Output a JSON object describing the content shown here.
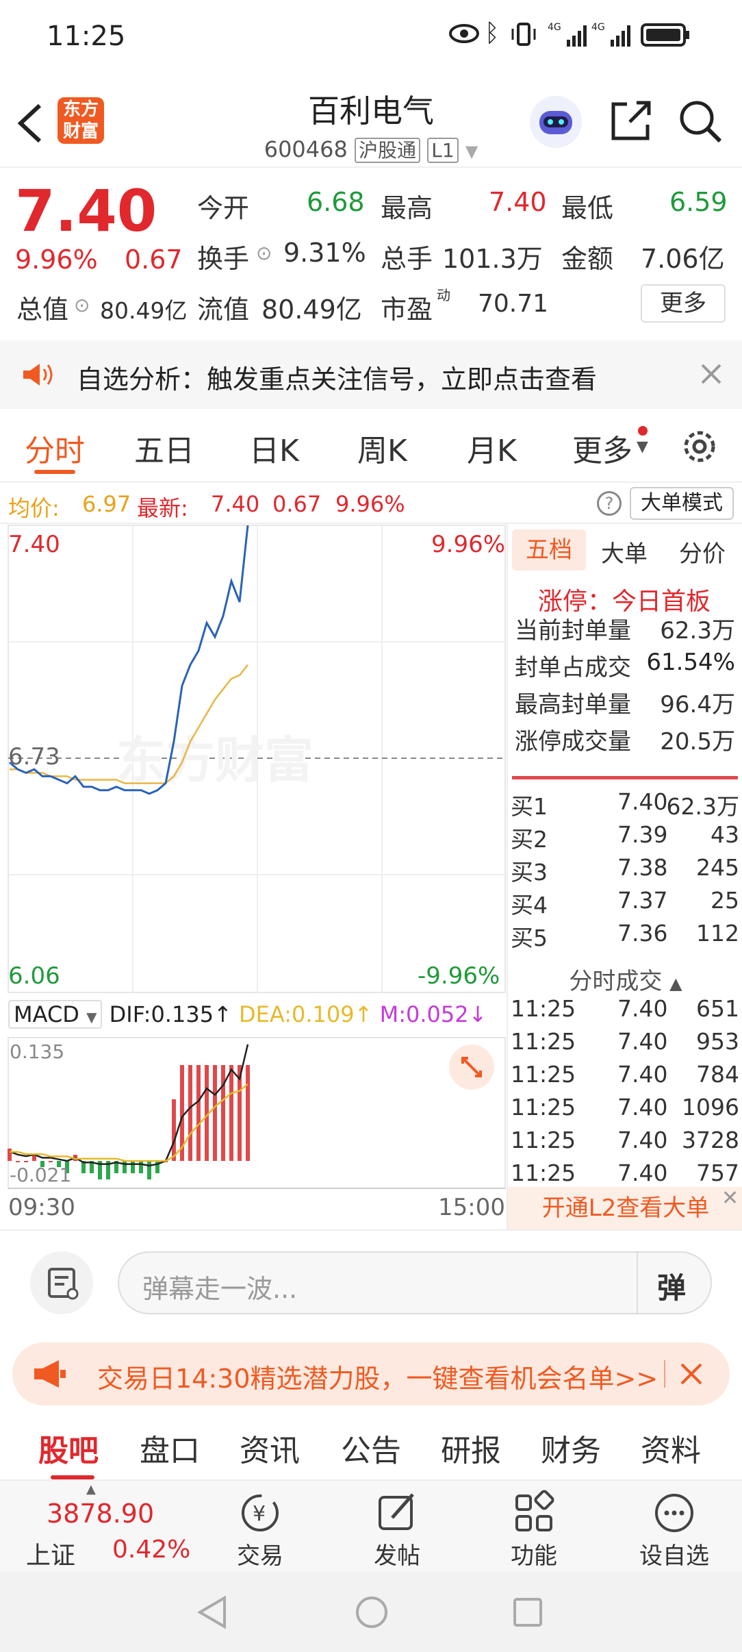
{
  "status": {
    "time": "11:25",
    "net1": "4G",
    "net2": "4G"
  },
  "header": {
    "logo": "东方财富",
    "title": "百利电气",
    "code": "600468",
    "exchange": "沪股通",
    "level": "L1"
  },
  "quote": {
    "price": "7.40",
    "change_pct": "9.96%",
    "change": "0.67",
    "open_label": "今开",
    "open": "6.68",
    "high_label": "最高",
    "high": "7.40",
    "low_label": "最低",
    "low": "6.59",
    "turnover_label": "换手",
    "turnover": "9.31%",
    "volume_label": "总手",
    "volume": "101.3万",
    "amount_label": "金额",
    "amount": "7.06亿",
    "mcap_label": "总值",
    "mcap": "80.49亿",
    "float_label": "流值",
    "float": "80.49亿",
    "pe_label": "市盈",
    "pe_sup": "动",
    "pe": "70.71",
    "more": "更多"
  },
  "notice": {
    "text": "自选分析：触发重点关注信号，立即点击查看"
  },
  "tabs": [
    "分时",
    "五日",
    "日K",
    "周K",
    "月K",
    "更多"
  ],
  "avgbar": {
    "avg_label": "均价:",
    "avg": "6.97",
    "last_label": "最新:",
    "last": "7.40",
    "chg": "0.67",
    "pct": "9.96%",
    "mode": "大单模式"
  },
  "chart": {
    "top_price": "7.40",
    "top_pct": "9.96%",
    "mid_price": "6.73",
    "bottom_price": "6.06",
    "bottom_pct": "-9.96%",
    "start_time": "09:30",
    "end_time": "15:00"
  },
  "chart_data": {
    "type": "line",
    "title": "",
    "xlabel": "",
    "ylabel": "",
    "ylim": [
      6.06,
      7.4
    ],
    "reference": 6.73,
    "series": [
      {
        "name": "最新",
        "values": [
          6.72,
          6.7,
          6.69,
          6.7,
          6.68,
          6.68,
          6.67,
          6.66,
          6.68,
          6.65,
          6.65,
          6.64,
          6.64,
          6.65,
          6.64,
          6.64,
          6.64,
          6.63,
          6.64,
          6.66,
          6.78,
          6.94,
          7.0,
          7.04,
          7.12,
          7.08,
          7.14,
          7.24,
          7.18,
          7.4
        ]
      },
      {
        "name": "均价",
        "values": [
          6.7,
          6.7,
          6.69,
          6.69,
          6.69,
          6.68,
          6.68,
          6.68,
          6.67,
          6.67,
          6.67,
          6.67,
          6.67,
          6.67,
          6.66,
          6.66,
          6.66,
          6.66,
          6.66,
          6.66,
          6.68,
          6.72,
          6.78,
          6.82,
          6.86,
          6.9,
          6.93,
          6.96,
          6.97,
          7.0
        ]
      }
    ]
  },
  "macd": {
    "label": "MACD",
    "dif": "DIF:0.135",
    "dea": "DEA:0.109",
    "m": "M:0.052",
    "top": "0.135",
    "bottom": "-0.021"
  },
  "side": {
    "tabs": [
      "五档",
      "大单",
      "分价"
    ],
    "limit": "涨停：今日首板",
    "stats": [
      [
        "当前封单量",
        "62.3万"
      ],
      [
        "封单占成交",
        "61.54%"
      ],
      [
        "最高封单量",
        "96.4万"
      ],
      [
        "涨停成交量",
        "20.5万"
      ]
    ],
    "book": [
      [
        "买1",
        "7.40",
        "62.3万"
      ],
      [
        "买2",
        "7.39",
        "43"
      ],
      [
        "买3",
        "7.38",
        "245"
      ],
      [
        "买4",
        "7.37",
        "25"
      ],
      [
        "买5",
        "7.36",
        "112"
      ]
    ],
    "trades_title": "分时成交",
    "trades": [
      [
        "11:25",
        "7.40",
        "651"
      ],
      [
        "11:25",
        "7.40",
        "953"
      ],
      [
        "11:25",
        "7.40",
        "784"
      ],
      [
        "11:25",
        "7.40",
        "1096"
      ],
      [
        "11:25",
        "7.40",
        "3728"
      ],
      [
        "11:25",
        "7.40",
        "757"
      ]
    ],
    "l2": "开通L2查看大单"
  },
  "danmu": {
    "placeholder": "弹幕走一波...",
    "btn": "弹"
  },
  "promo": {
    "text": "交易日14:30精选潜力股，一键查看机会名单>>"
  },
  "subtabs": [
    "股吧",
    "盘口",
    "资讯",
    "公告",
    "研报",
    "财务",
    "资料"
  ],
  "bottom": {
    "index_value": "3878.90",
    "index_name": "上证",
    "index_pct": "0.42%",
    "items": [
      "交易",
      "发帖",
      "功能",
      "设自选"
    ]
  }
}
